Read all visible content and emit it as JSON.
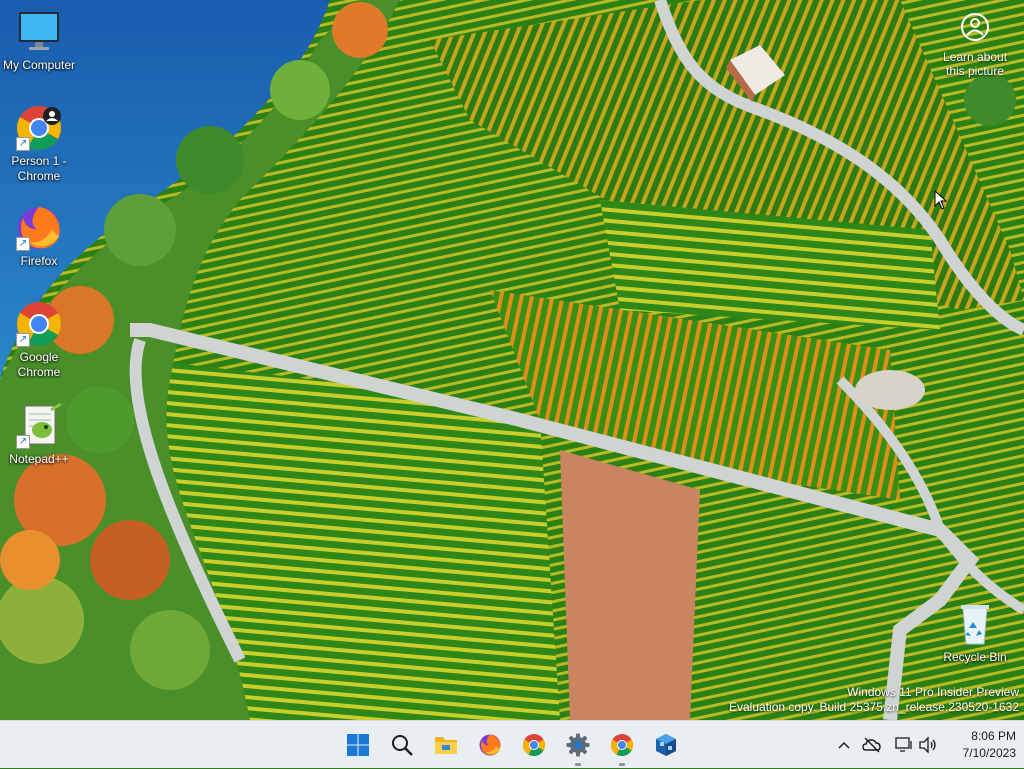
{
  "desktop": {
    "icons": [
      {
        "label": "My Computer",
        "icon": "monitor-icon"
      },
      {
        "label": "Person 1 - Chrome",
        "icon": "chrome-icon"
      },
      {
        "label": "Firefox",
        "icon": "firefox-icon"
      },
      {
        "label": "Google Chrome",
        "icon": "chrome-icon"
      },
      {
        "label": "Notepad++",
        "icon": "notepadpp-icon"
      },
      {
        "label": "Recycle Bin",
        "icon": "recycle-bin-icon"
      }
    ],
    "learn_about": "Learn about this picture",
    "watermark": {
      "line1": "Windows 11 Pro Insider Preview",
      "line2": "Evaluation copy. Build 25375.zn_release.230520-1632"
    }
  },
  "taskbar": {
    "apps": [
      {
        "name": "Start",
        "icon": "windows-start-icon",
        "running": false
      },
      {
        "name": "Search",
        "icon": "search-icon",
        "running": false
      },
      {
        "name": "File Explorer",
        "icon": "folder-icon",
        "running": false
      },
      {
        "name": "Firefox",
        "icon": "firefox-icon",
        "running": false
      },
      {
        "name": "Google Chrome",
        "icon": "chrome-icon",
        "running": false
      },
      {
        "name": "Settings",
        "icon": "gear-icon",
        "running": true
      },
      {
        "name": "Chrome",
        "icon": "chrome-icon",
        "running": true
      },
      {
        "name": "App",
        "icon": "cube-app-icon",
        "running": false
      }
    ],
    "tray": {
      "time": "8:06 PM",
      "date": "7/10/2023"
    }
  },
  "colors": {
    "taskbar_bg": "#e9eef3",
    "start_blue": "#1a78d6",
    "lake_blue": "#1b5fb0"
  }
}
